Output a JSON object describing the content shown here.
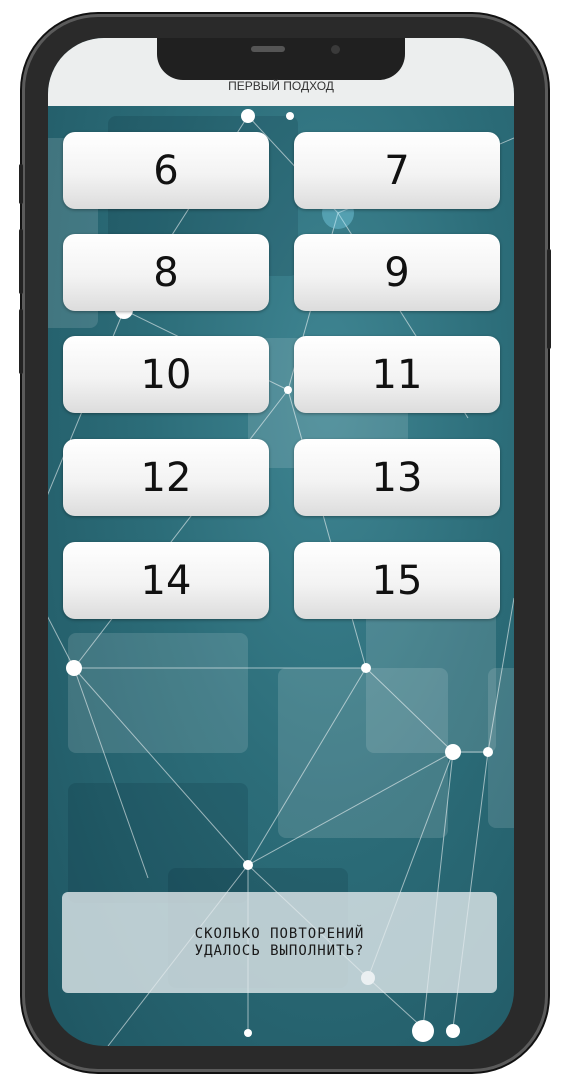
{
  "header": {
    "title": "ПЕРВЫЙ ПОДХОД"
  },
  "options": [
    "6",
    "7",
    "8",
    "9",
    "10",
    "11",
    "12",
    "13",
    "14",
    "15"
  ],
  "question": {
    "line1": "СКОЛЬКО ПОВТОРЕНИЙ",
    "line2": "УДАЛОСЬ ВЫПОЛНИТЬ?"
  }
}
